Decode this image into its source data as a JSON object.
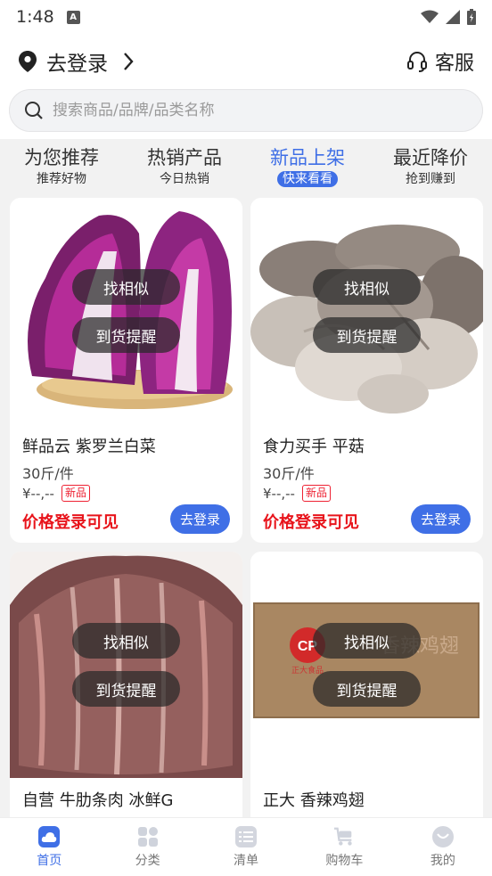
{
  "status": {
    "time": "1:48"
  },
  "header": {
    "login_text": "去登录",
    "service_text": "客服"
  },
  "search": {
    "placeholder": "搜索商品/品牌/品类名称"
  },
  "tabs": [
    {
      "title": "为您推荐",
      "sub": "推荐好物"
    },
    {
      "title": "热销产品",
      "sub": "今日热销"
    },
    {
      "title": "新品上架",
      "sub": "快来看看"
    },
    {
      "title": "最近降价",
      "sub": "抢到赚到"
    }
  ],
  "products": [
    {
      "name": "鲜品云 紫罗兰白菜",
      "unit": "30斤/件",
      "price": "¥--,--",
      "tag": "新品",
      "login_notice": "价格登录可见",
      "login_btn": "去登录",
      "similar": "找相似",
      "remind": "到货提醒"
    },
    {
      "name": "食力买手 平菇",
      "unit": "30斤/件",
      "price": "¥--,--",
      "tag": "新品",
      "login_notice": "价格登录可见",
      "login_btn": "去登录",
      "similar": "找相似",
      "remind": "到货提醒"
    },
    {
      "name": "自营 牛肋条肉 冰鲜G",
      "similar": "找相似",
      "remind": "到货提醒"
    },
    {
      "name": "正大 香辣鸡翅",
      "similar": "找相似",
      "remind": "到货提醒",
      "box_brand": "CP",
      "box_brand_name": "正大食品",
      "box_title": "香辣鸡翅"
    }
  ],
  "nav": [
    {
      "label": "首页",
      "icon": "home-icon"
    },
    {
      "label": "分类",
      "icon": "category-icon"
    },
    {
      "label": "清单",
      "icon": "list-icon"
    },
    {
      "label": "购物车",
      "icon": "cart-icon"
    },
    {
      "label": "我的",
      "icon": "profile-icon"
    }
  ],
  "colors": {
    "accent": "#3f6fe6",
    "price_red": "#e8141b"
  }
}
